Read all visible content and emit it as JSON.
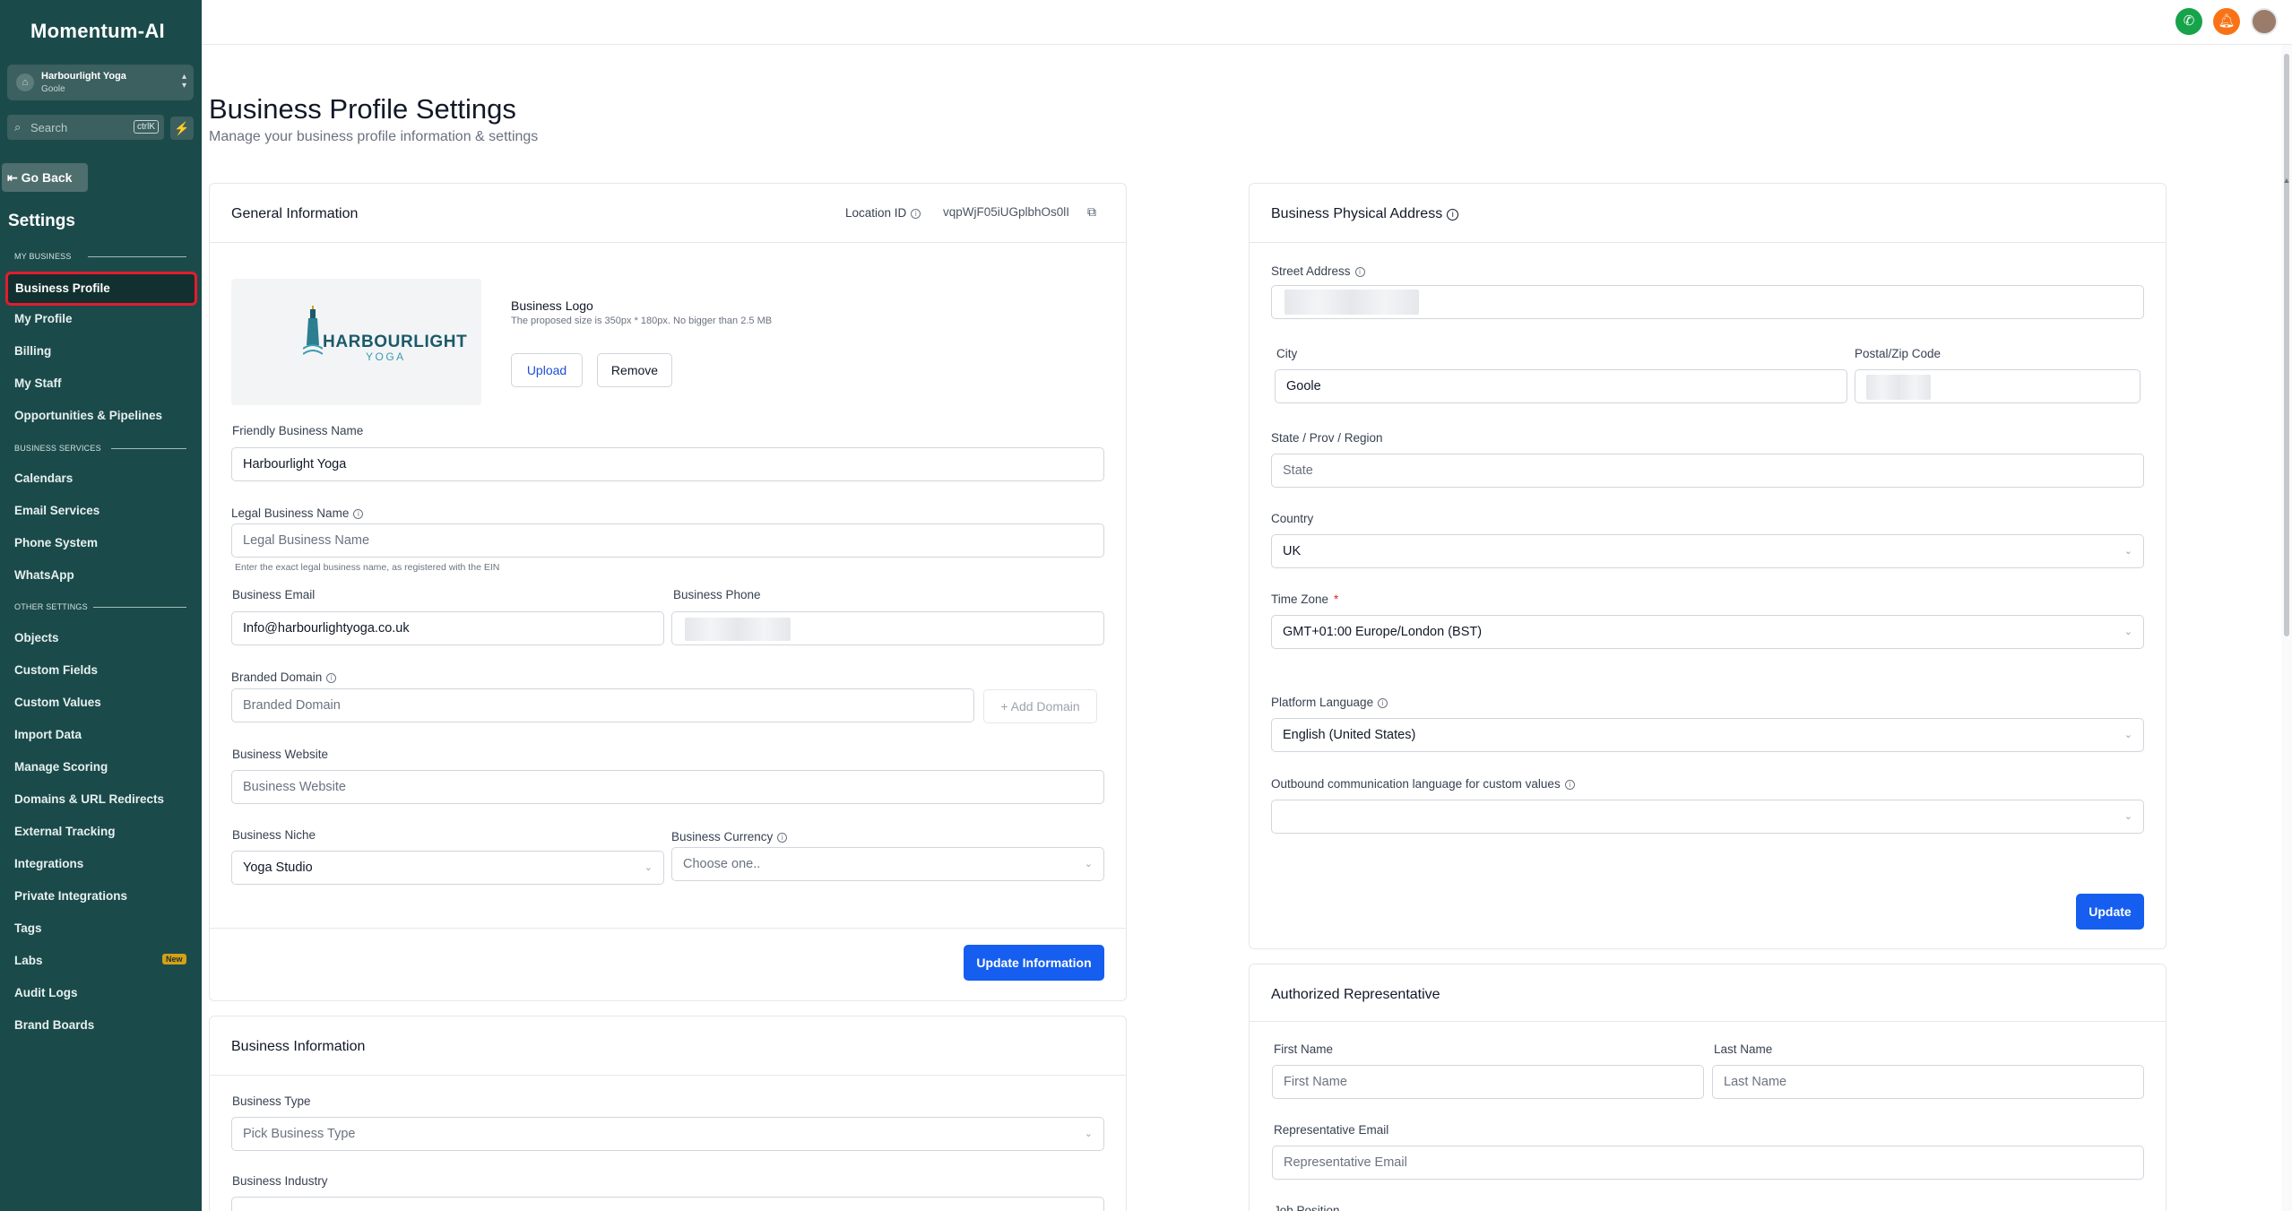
{
  "brand": {
    "name": "Momentum-AI"
  },
  "location": {
    "name": "Harbourlight Yoga",
    "city": "Goole"
  },
  "search": {
    "placeholder": "Search",
    "shortcut": "ctrlK"
  },
  "sidebar": {
    "go_back": "Go Back",
    "title": "Settings",
    "sections": {
      "my_business": "MY BUSINESS",
      "business_services": "BUSINESS SERVICES",
      "other_settings": "OTHER SETTINGS"
    },
    "items": {
      "business_profile": "Business Profile",
      "my_profile": "My Profile",
      "billing": "Billing",
      "my_staff": "My Staff",
      "opportunities": "Opportunities & Pipelines",
      "calendars": "Calendars",
      "email_services": "Email Services",
      "phone_system": "Phone System",
      "whatsapp": "WhatsApp",
      "objects": "Objects",
      "custom_fields": "Custom Fields",
      "custom_values": "Custom Values",
      "import_data": "Import Data",
      "manage_scoring": "Manage Scoring",
      "domains": "Domains & URL Redirects",
      "external_tracking": "External Tracking",
      "integrations": "Integrations",
      "private_integrations": "Private Integrations",
      "tags": "Tags",
      "labs": "Labs",
      "audit_logs": "Audit Logs",
      "brand_boards": "Brand Boards"
    },
    "labs_badge": "New"
  },
  "page": {
    "title": "Business Profile Settings",
    "subtitle": "Manage your business profile information & settings"
  },
  "general": {
    "title": "General Information",
    "location_id_label": "Location ID",
    "location_id": "vqpWjF05iUGplbhOs0lI",
    "logo_label": "Business Logo",
    "logo_hint": "The proposed size is 350px * 180px. No bigger than 2.5 MB",
    "logo_word": "HARBOURLIGHT",
    "logo_sub": "YOGA",
    "upload": "Upload",
    "remove": "Remove",
    "friendly_label": "Friendly Business Name",
    "friendly_value": "Harbourlight Yoga",
    "legal_label": "Legal Business Name",
    "legal_placeholder": "Legal Business Name",
    "legal_help": "Enter the exact legal business name, as registered with the EIN",
    "email_label": "Business Email",
    "email_value": "Info@harbourlightyoga.co.uk",
    "phone_label": "Business Phone",
    "domain_label": "Branded Domain",
    "domain_placeholder": "Branded Domain",
    "add_domain": "+ Add Domain",
    "website_label": "Business Website",
    "website_placeholder": "Business Website",
    "niche_label": "Business Niche",
    "niche_value": "Yoga Studio",
    "currency_label": "Business Currency",
    "currency_placeholder": "Choose one..",
    "update": "Update Information"
  },
  "business_info": {
    "title": "Business Information",
    "type_label": "Business Type",
    "type_placeholder": "Pick Business Type",
    "industry_label": "Business Industry"
  },
  "address": {
    "title": "Business Physical Address",
    "street_label": "Street Address",
    "city_label": "City",
    "city_value": "Goole",
    "postal_label": "Postal/Zip Code",
    "state_label": "State / Prov / Region",
    "state_placeholder": "State",
    "country_label": "Country",
    "country_value": "UK",
    "timezone_label": "Time Zone",
    "timezone_value": "GMT+01:00 Europe/London (BST)",
    "language_label": "Platform Language",
    "language_value": "English (United States)",
    "outbound_label": "Outbound communication language for custom values",
    "update": "Update"
  },
  "rep": {
    "title": "Authorized Representative",
    "first_label": "First Name",
    "first_placeholder": "First Name",
    "last_label": "Last Name",
    "last_placeholder": "Last Name",
    "email_label": "Representative Email",
    "email_placeholder": "Representative Email",
    "position_label": "Job Position"
  },
  "colors": {
    "sidebar": "#1b4a4a",
    "primary": "#155eef",
    "active_outline": "#e11d2e"
  }
}
